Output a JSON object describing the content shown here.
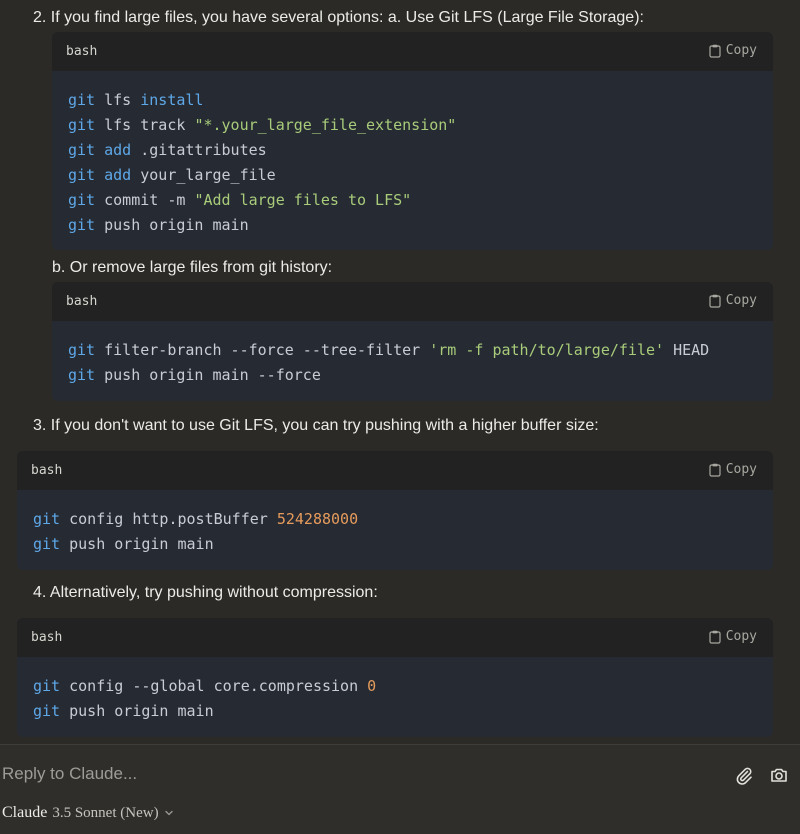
{
  "steps": {
    "s2": "2. If you find large files, you have several options: a. Use Git LFS (Large File Storage):",
    "s2b": "b. Or remove large files from git history:",
    "s3": "3. If you don't want to use Git LFS, you can try pushing with a higher buffer size:",
    "s4": "4. Alternatively, try pushing without compression:"
  },
  "code_blocks": [
    {
      "language": "bash",
      "copy_label": "Copy",
      "lines": [
        [
          {
            "t": "git",
            "c": "git"
          },
          {
            "t": " lfs ",
            "c": "pl"
          },
          {
            "t": "install",
            "c": "kw"
          }
        ],
        [
          {
            "t": "git",
            "c": "git"
          },
          {
            "t": " lfs track ",
            "c": "pl"
          },
          {
            "t": "\"*.your_large_file_extension\"",
            "c": "str"
          }
        ],
        [
          {
            "t": "git",
            "c": "git"
          },
          {
            "t": " ",
            "c": "pl"
          },
          {
            "t": "add",
            "c": "kw"
          },
          {
            "t": " .gitattributes",
            "c": "pl"
          }
        ],
        [
          {
            "t": "git",
            "c": "git"
          },
          {
            "t": " ",
            "c": "pl"
          },
          {
            "t": "add",
            "c": "kw"
          },
          {
            "t": " your_large_file",
            "c": "pl"
          }
        ],
        [
          {
            "t": "git",
            "c": "git"
          },
          {
            "t": " commit -m ",
            "c": "pl"
          },
          {
            "t": "\"Add large files to LFS\"",
            "c": "str"
          }
        ],
        [
          {
            "t": "git",
            "c": "git"
          },
          {
            "t": " push origin main",
            "c": "pl"
          }
        ]
      ]
    },
    {
      "language": "bash",
      "copy_label": "Copy",
      "lines": [
        [
          {
            "t": "git",
            "c": "git"
          },
          {
            "t": " filter-branch --force --tree-filter ",
            "c": "pl"
          },
          {
            "t": "'rm -f path/to/large/file'",
            "c": "str"
          },
          {
            "t": " HEAD",
            "c": "pl"
          }
        ],
        [
          {
            "t": "git",
            "c": "git"
          },
          {
            "t": " push origin main --force",
            "c": "pl"
          }
        ]
      ]
    },
    {
      "language": "bash",
      "copy_label": "Copy",
      "lines": [
        [
          {
            "t": "git",
            "c": "git"
          },
          {
            "t": " config http.postBuffer ",
            "c": "pl"
          },
          {
            "t": "524288000",
            "c": "num"
          }
        ],
        [
          {
            "t": "git",
            "c": "git"
          },
          {
            "t": " push origin main",
            "c": "pl"
          }
        ]
      ]
    },
    {
      "language": "bash",
      "copy_label": "Copy",
      "lines": [
        [
          {
            "t": "git",
            "c": "git"
          },
          {
            "t": " config --global core.compression ",
            "c": "pl"
          },
          {
            "t": "0",
            "c": "num"
          }
        ],
        [
          {
            "t": "git",
            "c": "git"
          },
          {
            "t": " push origin main",
            "c": "pl"
          }
        ]
      ]
    }
  ],
  "composer": {
    "placeholder": "Reply to Claude...",
    "attach_icon": "paperclip-icon",
    "camera_icon": "camera-icon",
    "model_name": "Claude",
    "model_version": "3.5 Sonnet (New)"
  },
  "colors": {
    "background": "#2b2a27",
    "code_bg": "#262a33",
    "code_header_bg": "#222222",
    "keyword": "#5ea8e8",
    "string": "#a8cc7a",
    "number": "#e69b5c"
  }
}
